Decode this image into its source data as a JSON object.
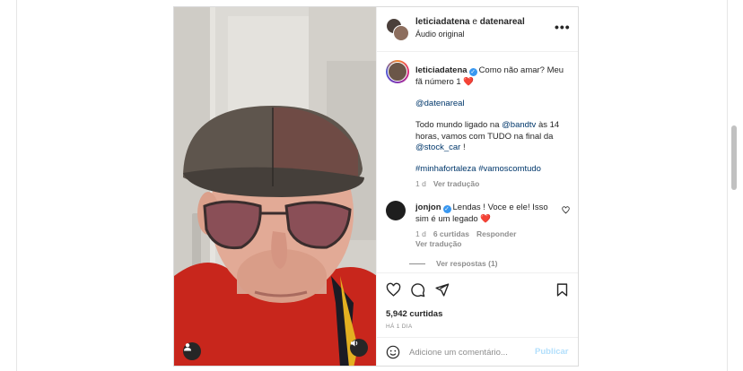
{
  "colors": {
    "accent_link": "#00376b",
    "verified_blue": "#3897f0",
    "publish_disabled": "#b2dffc",
    "meta_gray": "#8e8e8e",
    "heart_red": "#e0245e"
  },
  "header": {
    "user1": "leticiadatena",
    "conjunction": " e ",
    "user2": "datenareal",
    "subtitle": "Áudio original",
    "more_icon": "more-horizontal-icon",
    "more_glyph": "•••"
  },
  "caption": {
    "username": "leticiadatena",
    "line1": "Como não amar? Meu fã número 1",
    "heart": "❤️",
    "mention": "@datenareal",
    "body_a": "Todo mundo ligado na ",
    "body_mention1": "@bandtv",
    "body_b": " às 14 horas, vamos com TUDO na final da ",
    "body_mention2": "@stock_car",
    "body_c": " !",
    "hashtag1": "#minhafortaleza",
    "hashtag2": "#vamoscomtudo",
    "time": "1 d",
    "translate": "Ver tradução"
  },
  "comment": {
    "username": "jonjon",
    "text": "Lendas ! Voce e ele! Isso sim é um legado",
    "heart": "❤️",
    "time": "1 d",
    "likes": "6 curtidas",
    "reply": "Responder",
    "translate": "Ver tradução",
    "view_replies": "Ver respostas (1)"
  },
  "actions": {
    "likes": "5,942 curtidas",
    "ago": "HÁ 1 DIA",
    "icons": [
      "heart-icon",
      "comment-icon",
      "share-icon",
      "save-icon"
    ]
  },
  "add_comment": {
    "placeholder": "Adicione um comentário...",
    "publish": "Publicar",
    "emoji_icon": "emoji-icon"
  },
  "media": {
    "user_tag_icon": "user-tag-icon",
    "audio_icon": "volume-icon"
  }
}
